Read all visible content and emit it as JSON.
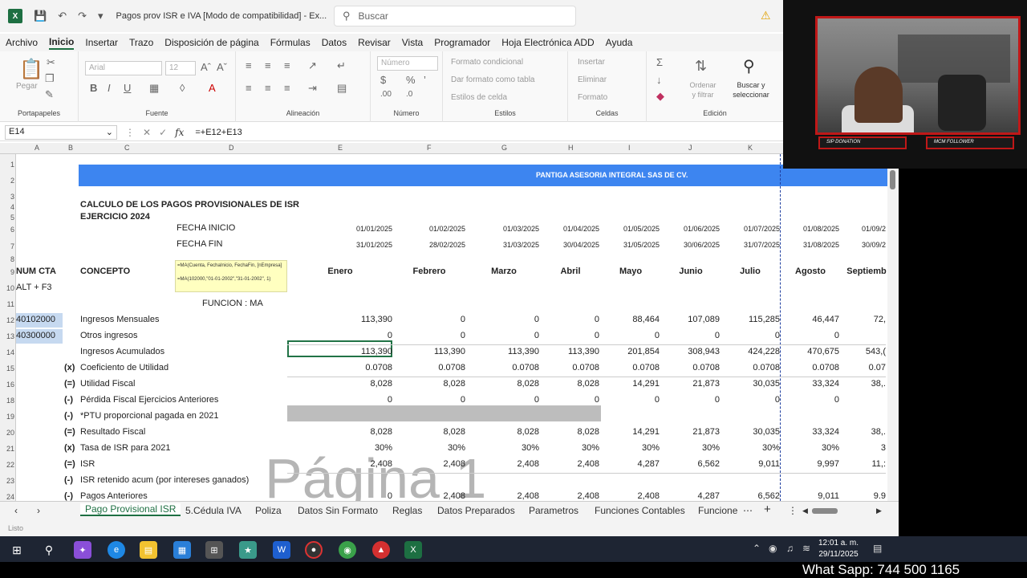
{
  "title_bar": {
    "app_icon": "excel-icon",
    "quick_access": [
      "save-icon",
      "undo-icon",
      "redo-icon",
      "customize-icon"
    ],
    "document_title": "Pagos prov ISR e IVA  [Modo de compatibilidad]  -  Ex...",
    "search_placeholder": "Buscar",
    "warning_icon": "warning-icon"
  },
  "menu": [
    "Archivo",
    "Inicio",
    "Insertar",
    "Trazo",
    "Disposición de página",
    "Fórmulas",
    "Datos",
    "Revisar",
    "Vista",
    "Programador",
    "Hoja Electrónica ADD",
    "Ayuda"
  ],
  "menu_active": "Inicio",
  "ribbon": {
    "groups": [
      "Portapapeles",
      "Fuente",
      "Alineación",
      "Número",
      "Estilos",
      "Celdas",
      "Edición"
    ],
    "paste": "Pegar",
    "font_name": "Arial",
    "font_size": "12",
    "number_format": "Número",
    "cond_format": "Formato condicional",
    "table_format": "Dar formato como tabla",
    "cell_styles": "Estilos de celda",
    "insert": "Insertar",
    "delete": "Eliminar",
    "format": "Formato",
    "sort_filter": "Ordenar y filtrar",
    "find_select": "Buscar y seleccionar"
  },
  "formula_bar": {
    "name_box": "E14",
    "fx": "fx",
    "formula": "=+E12+E13"
  },
  "columns": [
    "A",
    "B",
    "C",
    "D",
    "E",
    "F",
    "G",
    "H",
    "I",
    "J",
    "K"
  ],
  "rows": [
    "1",
    "2",
    "3",
    "4",
    "5",
    "6",
    "7",
    "8",
    "9",
    "10",
    "11",
    "12",
    "13",
    "14",
    "15",
    "16",
    "18",
    "19",
    "20",
    "21",
    "22",
    "23",
    "24"
  ],
  "sheet": {
    "banner": "PANTIGA ASESORIA INTEGRAL SAS DE CV.",
    "heading1": "CALCULO DE LOS PAGOS PROVISIONALES DE ISR",
    "heading2": "EJERCICIO 2024",
    "fecha_inicio": "FECHA INICIO",
    "fecha_fin": "FECHA FIN",
    "fechas_inicio": [
      "01/01/2025",
      "01/02/2025",
      "01/03/2025",
      "01/04/2025",
      "01/05/2025",
      "01/06/2025",
      "01/07/2025",
      "01/08/2025",
      "01/09/2"
    ],
    "fechas_fin": [
      "31/01/2025",
      "28/02/2025",
      "31/03/2025",
      "30/04/2025",
      "31/05/2025",
      "30/06/2025",
      "31/07/2025",
      "31/08/2025",
      "30/09/2"
    ],
    "num_cta": "NUM CTA",
    "concepto": "CONCEPTO",
    "months": [
      "Enero",
      "Febrero",
      "Marzo",
      "Abril",
      "Mayo",
      "Junio",
      "Julio",
      "Agosto",
      "Septiemb"
    ],
    "note_line1": "=MA(Cuenta, FechaInicio, FechaFin, [nEmpresa]",
    "note_line2": "=MA(102000,\"01-01-2002\",\"31-01-2002\", 1)",
    "alt_f3": "ALT + F3",
    "funcion": "FUNCION : MA",
    "cuenta1": "40102000",
    "cuenta2": "40300000",
    "data_rows": [
      {
        "op": "",
        "label": "Ingresos Mensuales",
        "values": [
          "113,390",
          "0",
          "0",
          "0",
          "88,464",
          "107,089",
          "115,285",
          "46,447",
          "72,"
        ]
      },
      {
        "op": "",
        "label": "Otros ingresos",
        "values": [
          "0",
          "0",
          "0",
          "0",
          "0",
          "0",
          "0",
          "0",
          ""
        ]
      },
      {
        "op": "",
        "label": "Ingresos Acumulados",
        "values": [
          "113,390",
          "113,390",
          "113,390",
          "113,390",
          "201,854",
          "308,943",
          "424,228",
          "470,675",
          "543,("
        ]
      },
      {
        "op": "(x)",
        "label": "Coeficiento de Utilidad",
        "values": [
          "0.0708",
          "0.0708",
          "0.0708",
          "0.0708",
          "0.0708",
          "0.0708",
          "0.0708",
          "0.0708",
          "0.07"
        ]
      },
      {
        "op": "(=)",
        "label": "Utilidad Fiscal",
        "values": [
          "8,028",
          "8,028",
          "8,028",
          "8,028",
          "14,291",
          "21,873",
          "30,035",
          "33,324",
          "38,."
        ]
      },
      {
        "op": "(-)",
        "label": "Pérdida Fiscal Ejercicios Anteriores",
        "values": [
          "0",
          "0",
          "0",
          "0",
          "0",
          "0",
          "0",
          "0",
          ""
        ]
      },
      {
        "op": "(-)",
        "label": "*PTU proporcional pagada en 2021",
        "values": [
          "",
          "",
          "",
          "",
          "",
          "",
          "",
          "",
          ""
        ]
      },
      {
        "op": "(=)",
        "label": "Resultado Fiscal",
        "values": [
          "8,028",
          "8,028",
          "8,028",
          "8,028",
          "14,291",
          "21,873",
          "30,035",
          "33,324",
          "38,."
        ]
      },
      {
        "op": "(x)",
        "label": "Tasa de ISR para 2021",
        "values": [
          "30%",
          "30%",
          "30%",
          "30%",
          "30%",
          "30%",
          "30%",
          "30%",
          "3"
        ]
      },
      {
        "op": "(=)",
        "label": "ISR",
        "values": [
          "2,408",
          "2,408",
          "2,408",
          "2,408",
          "4,287",
          "6,562",
          "9,011",
          "9,997",
          "11,:"
        ]
      },
      {
        "op": "(-)",
        "label": "ISR retenido acum (por intereses ganados)",
        "values": [
          "",
          "",
          "",
          "",
          "",
          "",
          "",
          "",
          ""
        ]
      },
      {
        "op": "(-)",
        "label": "Pagos Anteriores",
        "values": [
          "0",
          "2,408",
          "2,408",
          "2,408",
          "2,408",
          "4,287",
          "6,562",
          "9,011",
          "9.9"
        ]
      }
    ],
    "watermark": "Página 1"
  },
  "tabs": [
    "Pago Provisional ISR",
    "5.Cédula IVA",
    "Poliza",
    "Datos Sin Formato",
    "Reglas",
    "Datos Preparados",
    "Parametros",
    "Funciones Contables",
    "Funcione"
  ],
  "active_tab": "Pago Provisional ISR",
  "status": "Listo",
  "webcam": {
    "label1": "SIP DONATION",
    "label2": "MCM FOLLOWER"
  },
  "taskbar": {
    "apps": [
      "windows-start-icon",
      "search-icon",
      "copilot-icon",
      "edge-icon",
      "file-explorer-icon",
      "store-icon",
      "calculator-icon",
      "app-icon",
      "word-icon",
      "chrome-recorder-icon",
      "chrome-icon",
      "pdf-icon",
      "excel-icon"
    ],
    "time": "12:01 a. m.",
    "date": "29/11/2025"
  },
  "footer_text": "What Sapp: 744 500 1165",
  "colors": {
    "excel_green": "#1d6f42",
    "banner_blue": "#3d85f0",
    "webcam_red": "#c01818"
  }
}
